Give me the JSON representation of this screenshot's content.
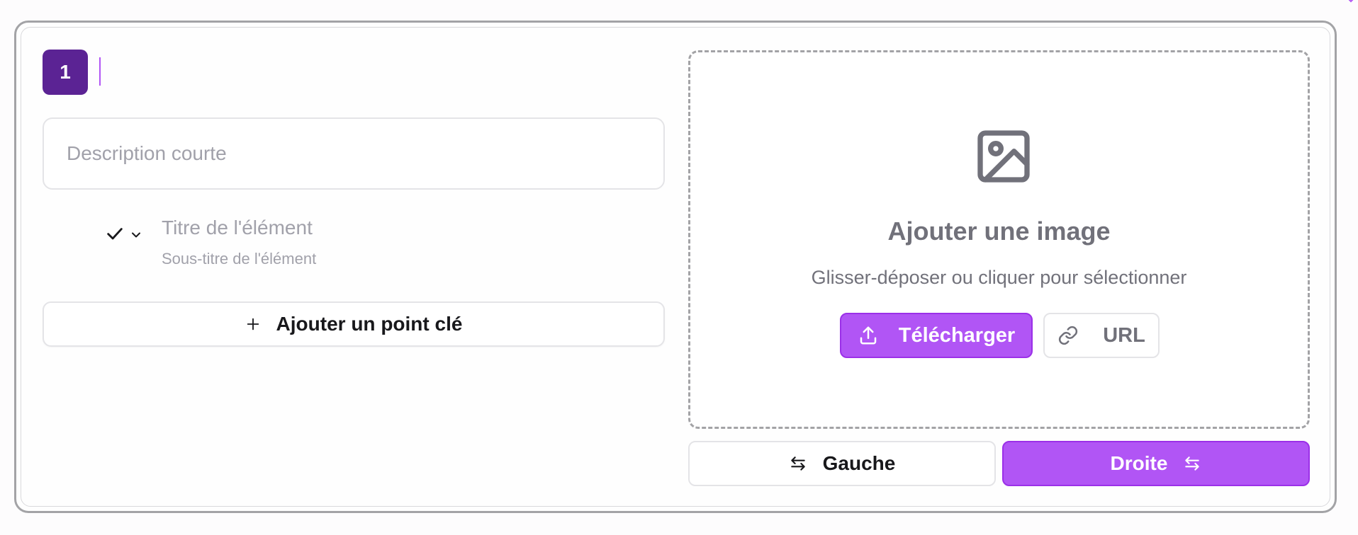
{
  "step": {
    "number": "1"
  },
  "description": {
    "placeholder": "Description courte",
    "value": ""
  },
  "key_point": {
    "title_placeholder": "Titre de l'élément",
    "subtitle_placeholder": "Sous-titre de l'élément"
  },
  "add_point_button": {
    "label": "Ajouter un point clé"
  },
  "image_dropzone": {
    "title": "Ajouter une image",
    "subtitle": "Glisser-déposer ou cliquer pour sélectionner",
    "upload_label": "Télécharger",
    "url_label": "URL"
  },
  "alignment": {
    "left_label": "Gauche",
    "right_label": "Droite",
    "selected": "Droite"
  },
  "icons": {
    "step": "number-badge",
    "check": "check-icon",
    "chevron": "chevron-down-icon",
    "plus": "plus-icon",
    "image": "image-icon",
    "upload": "upload-icon",
    "link": "link-icon",
    "swap": "swap-arrows-icon"
  },
  "colors": {
    "accent": "#b155f5",
    "badge": "#5b2394",
    "border": "#e4e4e7",
    "muted_text": "#a1a1aa",
    "dropzone_text": "#71717a"
  }
}
